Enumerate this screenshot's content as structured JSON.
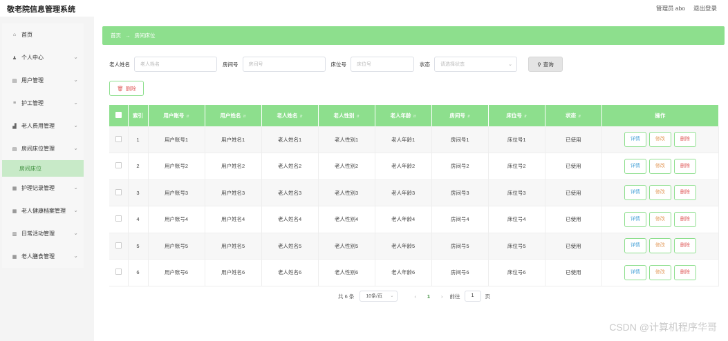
{
  "app": {
    "title": "敬老院信息管理系统"
  },
  "topbar": {
    "user": "管理员 abo",
    "logout": "退出登录"
  },
  "sidebar": {
    "items": [
      {
        "label": "首页",
        "icon": "home-icon",
        "glyph": "⌂",
        "has_chevron": false
      },
      {
        "label": "个人中心",
        "icon": "user-icon",
        "glyph": "♟",
        "has_chevron": true
      },
      {
        "label": "用户管理",
        "icon": "doc-icon",
        "glyph": "▤",
        "has_chevron": true
      },
      {
        "label": "护工管理",
        "icon": "menu-icon",
        "glyph": "≡",
        "has_chevron": true
      },
      {
        "label": "老人费用管理",
        "icon": "chart-icon",
        "glyph": "▟",
        "has_chevron": true
      },
      {
        "label": "房间床位管理",
        "icon": "doc-icon",
        "glyph": "▤",
        "has_chevron": true
      }
    ],
    "active_sub": "房间床位",
    "items_after": [
      {
        "label": "护理记录管理",
        "icon": "grid-icon",
        "glyph": "▦",
        "has_chevron": true
      },
      {
        "label": "老人健康档案管理",
        "icon": "grid-icon",
        "glyph": "▦",
        "has_chevron": true
      },
      {
        "label": "日常活动管理",
        "icon": "bar-icon",
        "glyph": "▥",
        "has_chevron": true
      },
      {
        "label": "老人膳食管理",
        "icon": "grid-icon",
        "glyph": "▦",
        "has_chevron": true
      }
    ]
  },
  "breadcrumb": {
    "home": "首页",
    "arrow": "→",
    "current": "房间床位"
  },
  "filters": {
    "name_label": "老人姓名",
    "name_placeholder": "老人姓名",
    "room_label": "房间号",
    "room_placeholder": "房间号",
    "bed_label": "床位号",
    "bed_placeholder": "床位号",
    "status_label": "状态",
    "status_placeholder": "请选择状态",
    "search_label": "查询"
  },
  "delete_button": "删除",
  "table": {
    "headers": {
      "index": "索引",
      "user_account": "用户账号",
      "user_name": "用户姓名",
      "elder_name": "老人姓名",
      "elder_gender": "老人性别",
      "elder_age": "老人年龄",
      "room": "房间号",
      "bed": "床位号",
      "status": "状态",
      "ops": "操作"
    },
    "rows": [
      {
        "index": "1",
        "user_account": "用户账号1",
        "user_name": "用户姓名1",
        "elder_name": "老人姓名1",
        "elder_gender": "老人性别1",
        "elder_age": "老人年龄1",
        "room": "房间号1",
        "bed": "床位号1",
        "status": "已使用"
      },
      {
        "index": "2",
        "user_account": "用户账号2",
        "user_name": "用户姓名2",
        "elder_name": "老人姓名2",
        "elder_gender": "老人性别2",
        "elder_age": "老人年龄2",
        "room": "房间号2",
        "bed": "床位号2",
        "status": "已使用"
      },
      {
        "index": "3",
        "user_account": "用户账号3",
        "user_name": "用户姓名3",
        "elder_name": "老人姓名3",
        "elder_gender": "老人性别3",
        "elder_age": "老人年龄3",
        "room": "房间号3",
        "bed": "床位号3",
        "status": "已使用"
      },
      {
        "index": "4",
        "user_account": "用户账号4",
        "user_name": "用户姓名4",
        "elder_name": "老人姓名4",
        "elder_gender": "老人性别4",
        "elder_age": "老人年龄4",
        "room": "房间号4",
        "bed": "床位号4",
        "status": "已使用"
      },
      {
        "index": "5",
        "user_account": "用户账号5",
        "user_name": "用户姓名5",
        "elder_name": "老人姓名5",
        "elder_gender": "老人性别5",
        "elder_age": "老人年龄5",
        "room": "房间号5",
        "bed": "床位号5",
        "status": "已使用"
      },
      {
        "index": "6",
        "user_account": "用户账号6",
        "user_name": "用户姓名6",
        "elder_name": "老人姓名6",
        "elder_gender": "老人性别6",
        "elder_age": "老人年龄6",
        "room": "房间号6",
        "bed": "床位号6",
        "status": "已使用"
      }
    ],
    "actions": {
      "view": "详情",
      "edit": "修改",
      "delete": "删除"
    }
  },
  "pagination": {
    "total": "共 6 条",
    "page_size": "10条/页",
    "current_page": "1",
    "goto_label": "前往",
    "goto_value": "1",
    "page_suffix": "页"
  },
  "watermark": "CSDN @计算机程序华哥",
  "colors": {
    "accent": "#8ddf8d",
    "active_bg": "#c8eac8",
    "active_text": "#3a8d3a",
    "danger": "#e06060",
    "edit": "#e39a5b",
    "info": "#4aa3d8"
  }
}
